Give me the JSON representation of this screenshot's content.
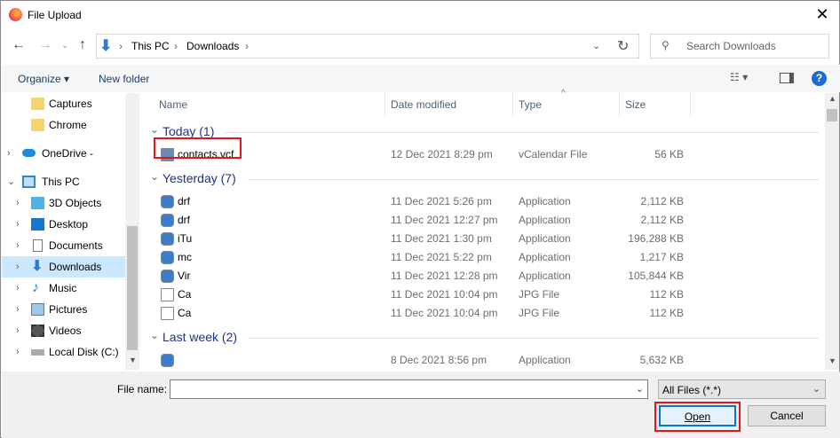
{
  "title": "File Upload",
  "address": {
    "crumbs": [
      "This PC",
      "Downloads"
    ]
  },
  "search": {
    "placeholder": "Search Downloads"
  },
  "toolbar": {
    "organize": "Organize",
    "new_folder": "New folder"
  },
  "sidebar": {
    "items": [
      {
        "label": "Captures"
      },
      {
        "label": "Chrome"
      },
      {
        "label": "OneDrive -"
      },
      {
        "label": "This PC"
      },
      {
        "label": "3D Objects"
      },
      {
        "label": "Desktop"
      },
      {
        "label": "Documents"
      },
      {
        "label": "Downloads"
      },
      {
        "label": "Music"
      },
      {
        "label": "Pictures"
      },
      {
        "label": "Videos"
      },
      {
        "label": "Local Disk (C:)"
      }
    ]
  },
  "columns": {
    "name": "Name",
    "date": "Date modified",
    "type": "Type",
    "size": "Size"
  },
  "groups": [
    {
      "label": "Today (1)",
      "files": [
        {
          "name": "contacts.vcf",
          "date": "12 Dec 2021 8:29 pm",
          "type": "vCalendar File",
          "size": "56 KB"
        }
      ]
    },
    {
      "label": "Yesterday (7)",
      "files": [
        {
          "name": "drf",
          "date": "11 Dec 2021 5:26 pm",
          "type": "Application",
          "size": "2,112 KB"
        },
        {
          "name": "drf",
          "date": "11 Dec 2021 12:27 pm",
          "type": "Application",
          "size": "2,112 KB"
        },
        {
          "name": "iTu",
          "date": "11 Dec 2021 1:30 pm",
          "type": "Application",
          "size": "196,288 KB"
        },
        {
          "name": "mc",
          "date": "11 Dec 2021 5:22 pm",
          "type": "Application",
          "size": "1,217 KB"
        },
        {
          "name": "Vir",
          "date": "11 Dec 2021 12:28 pm",
          "type": "Application",
          "size": "105,844 KB"
        },
        {
          "name": "Ca",
          "date": "11 Dec 2021 10:04 pm",
          "type": "JPG File",
          "size": "112 KB"
        },
        {
          "name": "Ca",
          "date": "11 Dec 2021 10:04 pm",
          "type": "JPG File",
          "size": "112 KB"
        }
      ]
    },
    {
      "label": "Last week (2)",
      "files": [
        {
          "name": "",
          "date": "8 Dec 2021 8:56 pm",
          "type": "Application",
          "size": "5,632 KB"
        }
      ]
    }
  ],
  "footer": {
    "file_name_label": "File name:",
    "file_name_value": "",
    "filter": "All Files (*.*)",
    "open": "Open",
    "cancel": "Cancel"
  },
  "colors": {
    "highlight": "#e0161d",
    "selected": "#cce8ff",
    "group": "#1e3287"
  }
}
